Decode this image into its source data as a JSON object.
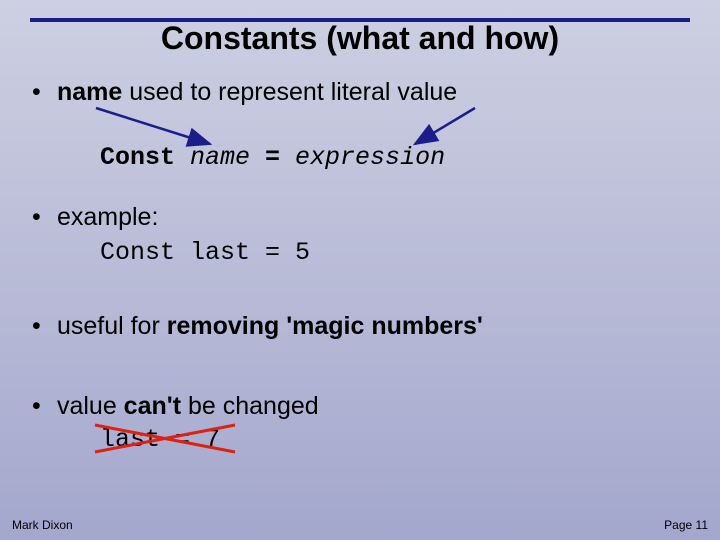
{
  "title": "Constants (what and how)",
  "bullets": {
    "b1_pre": "name",
    "b1_post": " used to represent literal value",
    "b2": "example:",
    "b3_pre": "useful for ",
    "b3_bold": "removing 'magic numbers'",
    "b4_pre": "value ",
    "b4_bold": "can't",
    "b4_post": " be changed"
  },
  "syntax": {
    "kw": "Const ",
    "name": "name",
    "eq": " = ",
    "expr": "expression"
  },
  "example_code": "Const last = 5",
  "bad_code": "last = 7",
  "footer": {
    "author": "Mark Dixon",
    "page": "Page 11"
  }
}
